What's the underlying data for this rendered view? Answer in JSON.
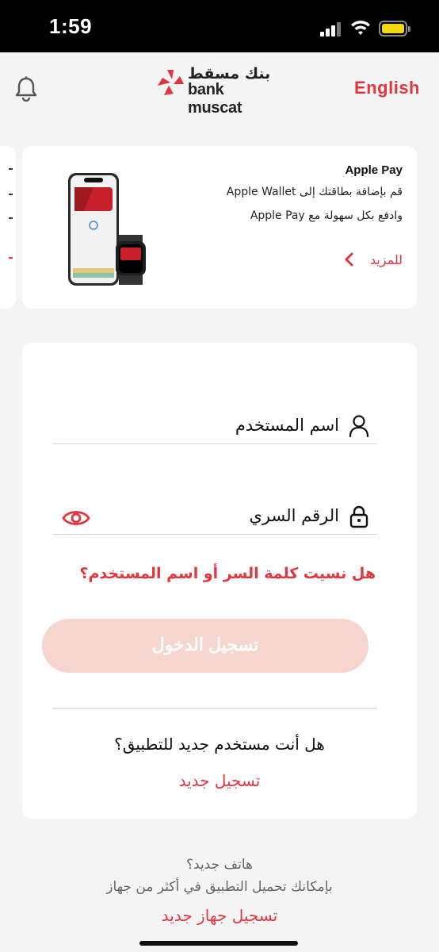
{
  "status_bar": {
    "time": "1:59"
  },
  "header": {
    "logo_arabic": "بنك مسقط",
    "logo_english": "bank muscat",
    "language_link": "English"
  },
  "promo": {
    "title": "Apple Pay",
    "line1": "قم بإضافة بطاقتك إلى Apple Wallet",
    "line2": "وادفع بكل سهولة مع Apple Pay",
    "more_link": "للمزيد"
  },
  "login": {
    "username_label": "اسم المستخدم",
    "password_label": "الرقم السري",
    "forgot_link": "هل نسيت كلمة السر أو اسم المستخدم؟",
    "login_button": "تسجيل الدخول",
    "new_user_question": "هل أنت مستخدم جديد للتطبيق؟",
    "register_link": "تسجيل جديد"
  },
  "footer": {
    "new_phone": "هاتف جديد؟",
    "multi_device": "بإمكانك تحميل التطبيق في أكثر من جهاز",
    "register_device_link": "تسجيل جهاز جديد"
  },
  "colors": {
    "accent": "#e2363f",
    "button_disabled": "#f7d5cf",
    "background": "#f4f4f4"
  },
  "icons": [
    "signal-icon",
    "wifi-icon",
    "battery-icon",
    "bell-icon",
    "user-icon",
    "lock-icon",
    "eye-icon",
    "chevron-left-icon"
  ]
}
